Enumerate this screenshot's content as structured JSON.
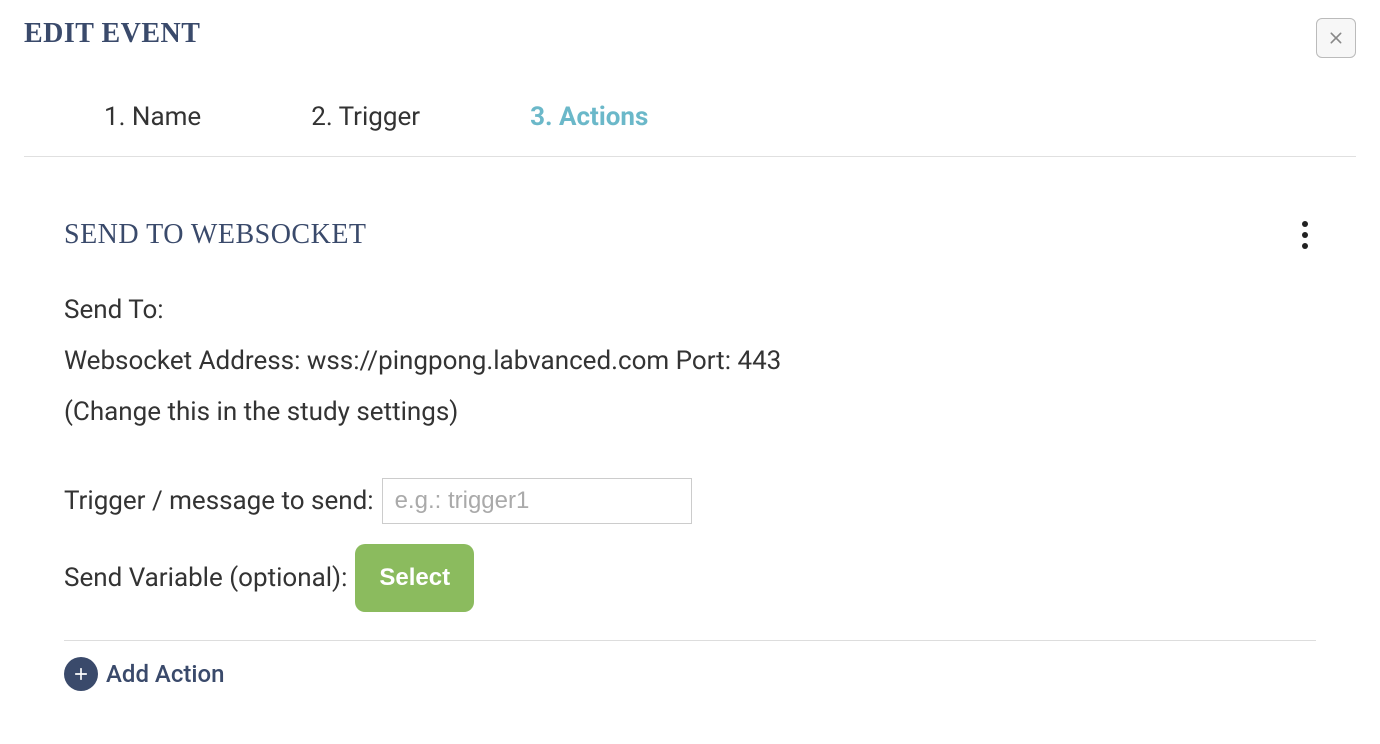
{
  "header": {
    "title": "EDIT EVENT"
  },
  "steps": {
    "items": [
      {
        "label": "1. Name",
        "active": false
      },
      {
        "label": "2. Trigger",
        "active": false
      },
      {
        "label": "3. Actions",
        "active": true
      }
    ]
  },
  "action": {
    "title": "SEND TO WEBSOCKET",
    "sendTo": {
      "label": "Send To:",
      "addressLabel": "Websocket Address:",
      "address": "wss://pingpong.labvanced.com",
      "portLabel": "Port:",
      "port": "443",
      "note": "(Change this in the study settings)"
    },
    "trigger": {
      "label": "Trigger / message to send:",
      "placeholder": "e.g.: trigger1",
      "value": ""
    },
    "sendVariable": {
      "label": "Send Variable (optional):",
      "buttonLabel": "Select"
    }
  },
  "addAction": {
    "label": "Add Action"
  }
}
